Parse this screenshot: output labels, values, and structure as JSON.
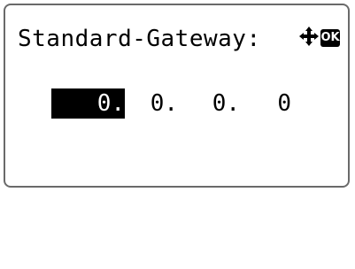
{
  "screen": {
    "title": "Standard-Gateway:",
    "ok_label": "OK",
    "nav_icon": "four-way-arrow-icon"
  },
  "ip": {
    "octets": [
      "0.",
      "0.",
      "0.",
      "0"
    ],
    "selected_index": 0
  },
  "colors": {
    "border": "#6a6a6a",
    "highlight": "#000000",
    "text": "#000000"
  }
}
